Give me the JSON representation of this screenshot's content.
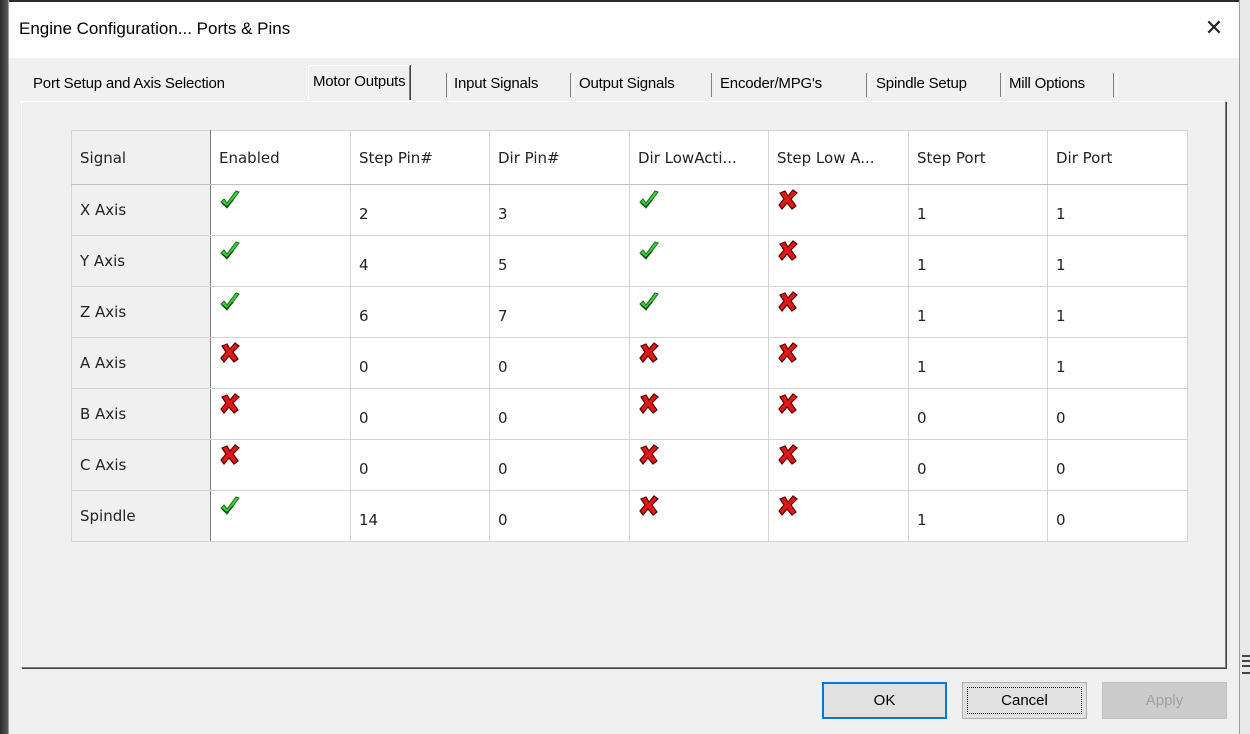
{
  "window": {
    "title": "Engine Configuration... Ports & Pins",
    "close_label": "✕"
  },
  "tabs": [
    {
      "label": "Port Setup and Axis Selection",
      "active": false
    },
    {
      "label": "Motor Outputs",
      "active": true
    },
    {
      "label": "Input Signals",
      "active": false
    },
    {
      "label": "Output Signals",
      "active": false
    },
    {
      "label": "Encoder/MPG's",
      "active": false
    },
    {
      "label": "Spindle Setup",
      "active": false
    },
    {
      "label": "Mill Options",
      "active": false
    }
  ],
  "table": {
    "headers": [
      "Signal",
      "Enabled",
      "Step Pin#",
      "Dir Pin#",
      "Dir LowActi...",
      "Step Low A...",
      "Step Port",
      "Dir Port"
    ],
    "rows": [
      {
        "signal": "X Axis",
        "enabled": true,
        "step_pin": "2",
        "dir_pin": "3",
        "dir_low_active": true,
        "step_low_active": false,
        "step_port": "1",
        "dir_port": "1"
      },
      {
        "signal": "Y Axis",
        "enabled": true,
        "step_pin": "4",
        "dir_pin": "5",
        "dir_low_active": true,
        "step_low_active": false,
        "step_port": "1",
        "dir_port": "1"
      },
      {
        "signal": "Z Axis",
        "enabled": true,
        "step_pin": "6",
        "dir_pin": "7",
        "dir_low_active": true,
        "step_low_active": false,
        "step_port": "1",
        "dir_port": "1"
      },
      {
        "signal": "A Axis",
        "enabled": false,
        "step_pin": "0",
        "dir_pin": "0",
        "dir_low_active": false,
        "step_low_active": false,
        "step_port": "1",
        "dir_port": "1"
      },
      {
        "signal": "B Axis",
        "enabled": false,
        "step_pin": "0",
        "dir_pin": "0",
        "dir_low_active": false,
        "step_low_active": false,
        "step_port": "0",
        "dir_port": "0"
      },
      {
        "signal": "C Axis",
        "enabled": false,
        "step_pin": "0",
        "dir_pin": "0",
        "dir_low_active": false,
        "step_low_active": false,
        "step_port": "0",
        "dir_port": "0"
      },
      {
        "signal": "Spindle",
        "enabled": true,
        "step_pin": "14",
        "dir_pin": "0",
        "dir_low_active": false,
        "step_low_active": false,
        "step_port": "1",
        "dir_port": "0"
      }
    ]
  },
  "buttons": {
    "ok": "OK",
    "cancel": "Cancel",
    "apply": "Apply"
  },
  "icons": {
    "true": "green-check-icon",
    "false": "red-x-icon"
  },
  "colors": {
    "check_green": "#3cd23c",
    "x_red": "#e01818",
    "window_bg": "#f0f0f0"
  }
}
